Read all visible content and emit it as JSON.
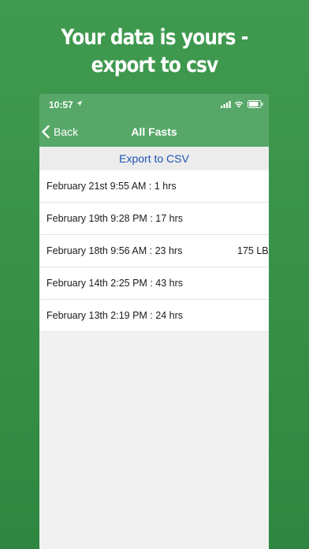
{
  "headline": {
    "line1": "Your data is yours -",
    "line2": "export to csv"
  },
  "status_bar": {
    "time": "10:57",
    "icons": [
      "location-arrow-icon",
      "signal-icon",
      "wifi-icon",
      "battery-icon"
    ]
  },
  "navbar": {
    "back_label": "Back",
    "title": "All Fasts"
  },
  "export": {
    "label": "Export to CSV"
  },
  "fasts": [
    {
      "label": "February 21st 9:55 AM : 1 hrs",
      "weight": ""
    },
    {
      "label": "February 19th 9:28 PM : 17 hrs",
      "weight": ""
    },
    {
      "label": "February 18th 9:56 AM : 23 hrs",
      "weight": "175 LB"
    },
    {
      "label": "February 14th 2:25 PM : 43 hrs",
      "weight": ""
    },
    {
      "label": "February 13th 2:19 PM : 24 hrs",
      "weight": ""
    }
  ],
  "colors": {
    "background": "#3a934a",
    "navbar": "#57a868",
    "link": "#1e53b6",
    "list_background": "#f1f1f1"
  }
}
